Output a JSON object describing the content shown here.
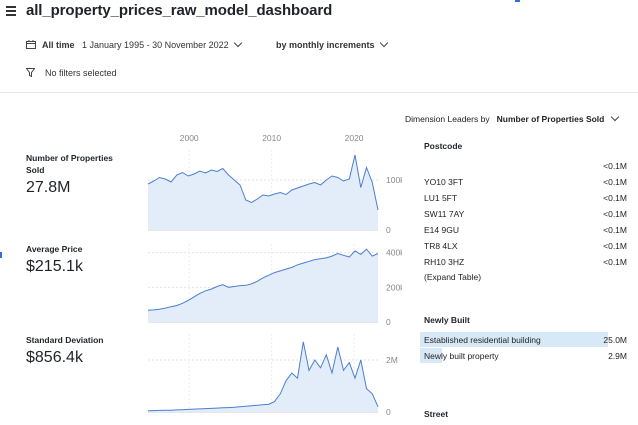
{
  "header": {
    "title": "all_property_prices_raw_model_dashboard"
  },
  "toolbar": {
    "range_label": "All time",
    "range_value": "1 January 1995 - 30 November 2022",
    "increment_label": "by monthly increments",
    "filters_label": "No filters selected"
  },
  "axis": {
    "years": [
      "2000",
      "2010",
      "2020"
    ]
  },
  "metrics": [
    {
      "label_line1": "Number of Properties",
      "label_line2": "Sold",
      "value": "27.8M",
      "ticks": [
        "100k",
        "0"
      ]
    },
    {
      "label_line1": "Average Price",
      "label_line2": "",
      "value": "$215.1k",
      "ticks": [
        "400k",
        "200k",
        "0"
      ]
    },
    {
      "label_line1": "Standard Deviation",
      "label_line2": "",
      "value": "$856.4k",
      "ticks": [
        "2M",
        "0"
      ]
    }
  ],
  "leaders": {
    "prefix": "Dimension Leaders by",
    "metric": "Number of Properties Sold"
  },
  "postcode": {
    "title": "Postcode",
    "rows": [
      {
        "name": "",
        "value": "<0.1M"
      },
      {
        "name": "YO10 3FT",
        "value": "<0.1M"
      },
      {
        "name": "LU1 5FT",
        "value": "<0.1M"
      },
      {
        "name": "SW11 7AY",
        "value": "<0.1M"
      },
      {
        "name": "E14 9GU",
        "value": "<0.1M"
      },
      {
        "name": "TR8 4LX",
        "value": "<0.1M"
      },
      {
        "name": "RH10 3HZ",
        "value": "<0.1M"
      }
    ],
    "expand": "(Expand Table)"
  },
  "newly_built": {
    "title": "Newly Built",
    "rows": [
      {
        "name": "Established residential building",
        "value": "25.0M",
        "share": 0.896
      },
      {
        "name": "Newly built property",
        "value": "2.9M",
        "share": 0.104
      }
    ]
  },
  "street": {
    "title": "Street"
  },
  "colors": {
    "line": "#4a7fcf",
    "fill": "#e3edfa",
    "bar": "#d7e8f7"
  },
  "chart_data": [
    {
      "type": "area",
      "title": "Number of Properties Sold",
      "x": [
        1995,
        2022.9
      ],
      "ylim": [
        0,
        160000
      ],
      "yticks": [
        0,
        100000
      ],
      "series": [
        {
          "values": [
            92000,
            98000,
            105000,
            102000,
            96000,
            110000,
            115000,
            108000,
            112000,
            118000,
            114000,
            120000,
            117000,
            123000,
            110000,
            100000,
            90000,
            60000,
            55000,
            62000,
            70000,
            68000,
            72000,
            75000,
            71000,
            80000,
            84000,
            88000,
            92000,
            95000,
            90000,
            100000,
            108000,
            105000,
            98000,
            102000,
            150000,
            85000,
            125000,
            95000,
            40000
          ]
        }
      ]
    },
    {
      "type": "area",
      "title": "Average Price",
      "x": [
        1995,
        2022.9
      ],
      "ylim": [
        0,
        450000
      ],
      "yticks": [
        0,
        200000,
        400000
      ],
      "series": [
        {
          "values": [
            68000,
            70000,
            74000,
            80000,
            88000,
            95000,
            108000,
            125000,
            145000,
            165000,
            180000,
            190000,
            205000,
            215000,
            200000,
            205000,
            210000,
            212000,
            220000,
            235000,
            255000,
            270000,
            285000,
            295000,
            305000,
            315000,
            330000,
            340000,
            350000,
            360000,
            365000,
            370000,
            380000,
            395000,
            385000,
            375000,
            410000,
            390000,
            420000,
            380000,
            395000
          ]
        }
      ]
    },
    {
      "type": "area",
      "title": "Standard Deviation",
      "x": [
        1995,
        2022.9
      ],
      "ylim": [
        0,
        3000000
      ],
      "yticks": [
        0,
        2000000
      ],
      "series": [
        {
          "values": [
            50000,
            55000,
            60000,
            65000,
            70000,
            80000,
            90000,
            100000,
            110000,
            120000,
            130000,
            140000,
            150000,
            160000,
            170000,
            180000,
            200000,
            220000,
            240000,
            260000,
            280000,
            300000,
            400000,
            700000,
            1200000,
            1500000,
            1300000,
            2700000,
            1600000,
            2000000,
            1700000,
            2200000,
            1500000,
            2500000,
            1600000,
            1900000,
            1300000,
            2000000,
            900000,
            700000,
            200000
          ]
        }
      ]
    }
  ]
}
